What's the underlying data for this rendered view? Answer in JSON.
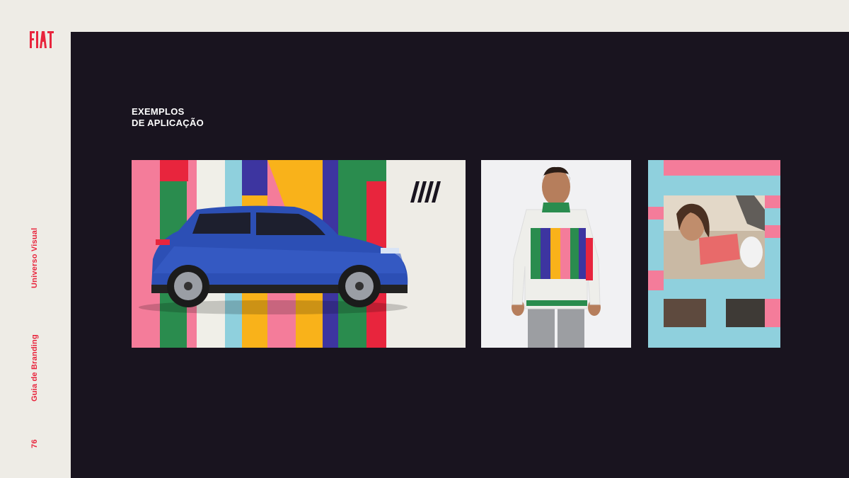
{
  "brand": {
    "logo_text": "FIAT",
    "accent_color": "#e8253d"
  },
  "sidebar": {
    "section_label": "Universo Visual",
    "guide_label": "Guia de Branding",
    "page_number": "76"
  },
  "page": {
    "title_line1": "EXEMPLOS",
    "title_line2": "DE APLICAÇÃO",
    "background_color": "#19141f"
  },
  "images": {
    "car": {
      "subject": "blue-hatchback-car",
      "background": "colorful-fiat-letter-stripes"
    },
    "apparel": {
      "subject": "woman-in-striped-jacket"
    },
    "photo": {
      "subject": "woman-in-car-framed-by-fiat-letters"
    }
  },
  "palette": [
    "#f47c9a",
    "#2a8c4e",
    "#f0efe8",
    "#8fd0dd",
    "#f9b21a",
    "#3d35a0",
    "#e8253d"
  ]
}
